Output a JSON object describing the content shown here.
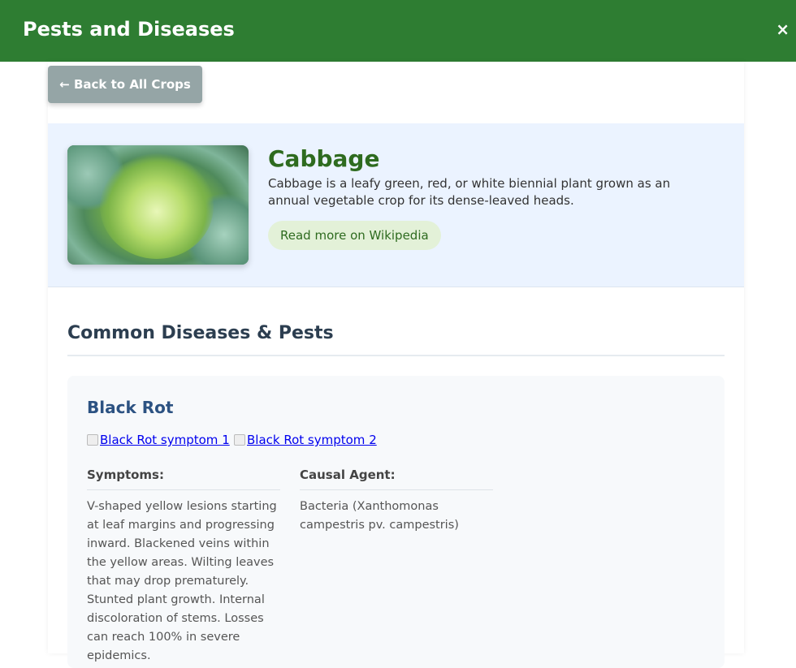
{
  "header": {
    "title": "Pests and Diseases",
    "close_label": "×"
  },
  "back_button": {
    "label": "← Back to All Crops"
  },
  "crop": {
    "name": "Cabbage",
    "description": "Cabbage is a leafy green, red, or white biennial plant grown as an annual vegetable crop for its dense-leaved heads.",
    "wiki_label": "Read more on Wikipedia"
  },
  "section": {
    "title": "Common Diseases & Pests"
  },
  "diseases": [
    {
      "name": "Black Rot",
      "images": [
        "Black Rot symptom 1",
        "Black Rot symptom 2"
      ],
      "symptoms_label": "Symptoms:",
      "symptoms": "V-shaped yellow lesions starting at leaf margins and progressing inward. Blackened veins within the yellow areas. Wilting leaves that may drop prematurely. Stunted plant growth. Internal discoloration of stems. Losses can reach 100% in severe epidemics.",
      "agent_label": "Causal Agent:",
      "agent": "Bacteria (Xanthomonas campestris pv. campestris)"
    }
  ],
  "colors": {
    "header_bg": "#2e7d32",
    "back_button_bg": "#95a5a6",
    "crop_header_bg": "#ebf3ff",
    "crop_name": "#2e6b1f",
    "wiki_link_bg": "#e3f1d8",
    "disease_name": "#2c5282"
  }
}
